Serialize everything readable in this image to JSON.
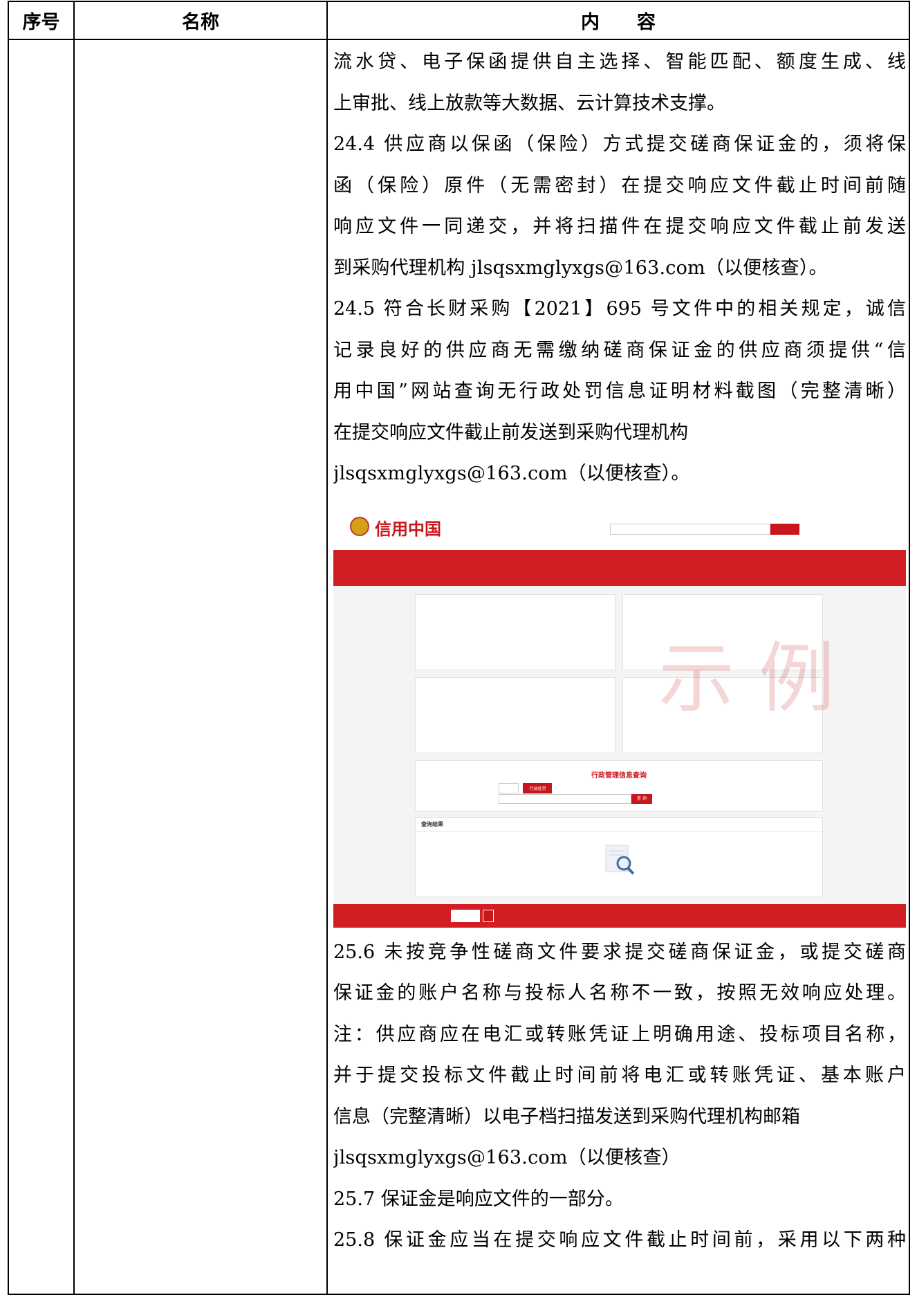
{
  "table": {
    "headers": [
      "序号",
      "名称",
      "内　　容"
    ]
  },
  "content": {
    "lines_before": [
      "流水贷、电子保函提供自主选择、智能匹配、额度生成、线",
      "上审批、线上放款等大数据、云计算技术支撑。",
      "24.4 供应商以保函（保险）方式提交磋商保证金的，须将保",
      "函（保险）原件（无需密封）在提交响应文件截止时间前随",
      "响应文件一同递交，并将扫描件在提交响应文件截止前发送",
      "到采购代理机构 jlsqsxmglyxgs@163.com（以便核查）。",
      "24.5 符合长财采购【2021】695 号文件中的相关规定，诚信",
      "记录良好的供应商无需缴纳磋商保证金的供应商须提供“信",
      "用中国”网站查询无行政处罚信息证明材料截图（完整清晰）",
      "在提交响应文件截止前发送到采购代理机构",
      "jlsqsxmglyxgs@163.com（以便核查）。"
    ],
    "lines_after": [
      "25.6 未按竞争性磋商文件要求提交磋商保证金，或提交磋商",
      "保证金的账户名称与投标人名称不一致，按照无效响应处理。",
      "注：供应商应在电汇或转账凭证上明确用途、投标项目名称，",
      "并于提交投标文件截止时间前将电汇或转账凭证、基本账户",
      "信息（完整清晰）以电子档扫描发送到采购代理机构邮箱",
      "jlsqsxmglyxgs@163.com（以便核查）",
      "25.7 保证金是响应文件的一部分。",
      "25.8 保证金应当在提交响应文件截止时间前，采用以下两种"
    ]
  },
  "screenshot": {
    "logo_text": "信用中国",
    "watermark": "示 例",
    "query_title": "行政管理信息查询",
    "query_tab_active": "行政处罚",
    "results_title": "查询结果",
    "search_button": "查 询"
  }
}
